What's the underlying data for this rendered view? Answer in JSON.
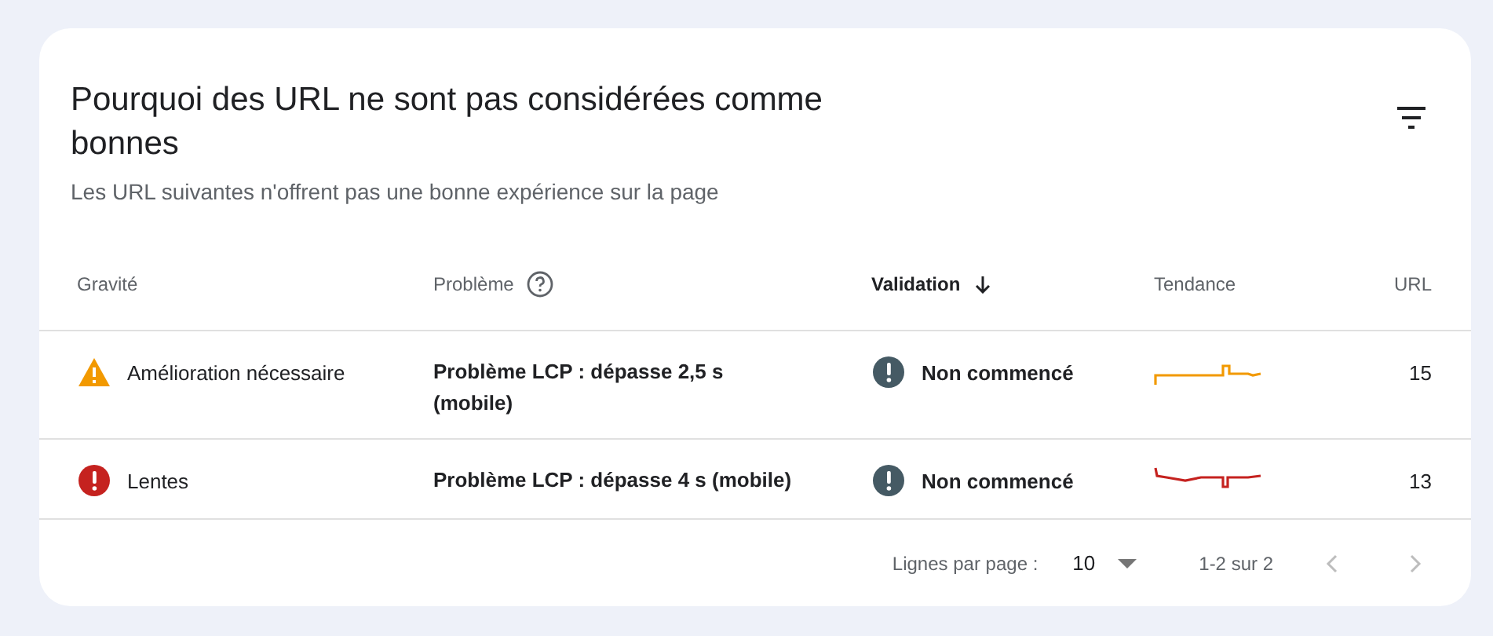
{
  "card": {
    "title": "Pourquoi des URL ne sont pas considérées comme bonnes",
    "subtitle": "Les URL suivantes n'offrent pas une bonne expérience sur la page"
  },
  "table": {
    "columns": [
      {
        "label": "Gravité",
        "sorted": false,
        "help": false
      },
      {
        "label": "Problème",
        "sorted": false,
        "help": true
      },
      {
        "label": "Validation",
        "sorted": true,
        "help": false
      },
      {
        "label": "Tendance",
        "sorted": false,
        "help": false
      },
      {
        "label": "URL",
        "sorted": false,
        "help": false
      }
    ],
    "rows": [
      {
        "severity": {
          "kind": "warning",
          "label": "Amélioration nécessaire"
        },
        "problem": "Problème LCP : dépasse 2,5 s (mobile)",
        "validation": "Non commencé",
        "urls": "15"
      },
      {
        "severity": {
          "kind": "error",
          "label": "Lentes"
        },
        "problem": "Problème LCP : dépasse 4 s (mobile)",
        "validation": "Non commencé",
        "urls": "13"
      }
    ]
  },
  "pagination": {
    "rows_label": "Lignes par page :",
    "rows_per_page": "10",
    "range": "1-2 sur 2",
    "previous_disabled": true,
    "next_disabled": true
  }
}
